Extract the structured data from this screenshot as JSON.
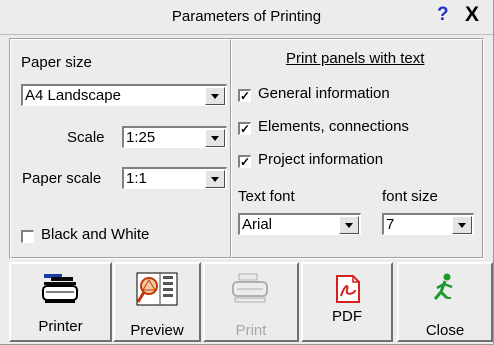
{
  "window": {
    "title": "Parameters of Printing",
    "help_label": "?",
    "close_label": "X"
  },
  "left": {
    "paper_size_label": "Paper size",
    "paper_size_value": "A4 Landscape",
    "scale_label": "Scale",
    "scale_value": "1:25",
    "paper_scale_label": "Paper scale",
    "paper_scale_value": "1:1",
    "black_white_label": "Black and White",
    "black_white_checked": false
  },
  "right": {
    "heading": "Print panels with text",
    "options": [
      {
        "label": "General information",
        "checked": true
      },
      {
        "label": "Elements, connections",
        "checked": true
      },
      {
        "label": "Project information",
        "checked": true
      }
    ],
    "text_font_label": "Text font",
    "text_font_value": "Arial",
    "font_size_label": "font size",
    "font_size_value": "7"
  },
  "buttons": {
    "printer": "Printer",
    "preview": "Preview",
    "print": "Print",
    "pdf": "PDF",
    "close": "Close"
  },
  "icons": {
    "printer": "printer-icon",
    "preview": "preview-icon",
    "print": "print-icon",
    "pdf": "pdf-icon",
    "close": "exit-icon"
  },
  "colors": {
    "accent": "#1f35c8",
    "pdf": "#d52020",
    "exit": "#1a9a2a",
    "background": "#ececec"
  }
}
